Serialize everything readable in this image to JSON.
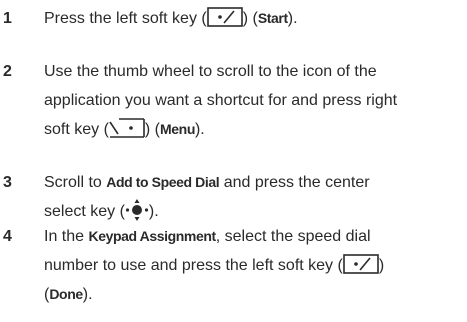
{
  "steps": [
    {
      "number": "1",
      "line1_a": "Press the left soft key (",
      "line1_b": ") (",
      "line1_bold": "Start",
      "line1_c": ").",
      "icon": "left-soft-key-icon"
    },
    {
      "number": "2",
      "line1": "Use the thumb wheel to scroll to the icon of the",
      "line2": "application you want a shortcut for and press right",
      "line3_a": "soft key (",
      "line3_b": ") (",
      "line3_bold": "Menu",
      "line3_c": ").",
      "icon": "right-soft-key-icon"
    },
    {
      "number": "3",
      "line1_a": "Scroll to ",
      "line1_bold": "Add to Speed Dial",
      "line1_b": " and press the center",
      "line2_a": "select key (",
      "line2_b": ").",
      "icon": "center-select-key-icon"
    },
    {
      "number": "4",
      "line1_a": "In the ",
      "line1_bold": "Keypad Assignment",
      "line1_b": ", select the speed dial",
      "line2_a": "number to use and press the left soft key (",
      "line2_b": ")",
      "line3_a": "(",
      "line3_bold": "Done",
      "line3_b": ").",
      "icon": "left-soft-key-icon"
    }
  ]
}
